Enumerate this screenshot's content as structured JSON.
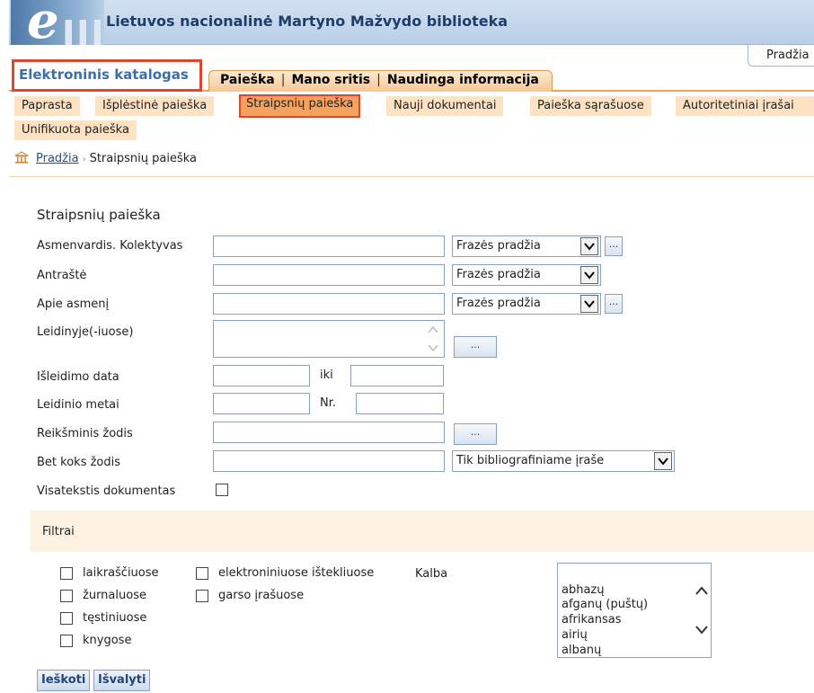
{
  "header": {
    "logo_letter": "e",
    "site_title": "Lietuvos nacionalinė Martyno Mažvydo biblioteka",
    "home_link": "Pradžia"
  },
  "tabs": {
    "catalog": "Elektroninis katalogas",
    "main": [
      "Paieška",
      "Mano sritis",
      "Naudinga informacija"
    ],
    "separator": "|"
  },
  "subtabs": [
    {
      "label": "Paprasta",
      "active": false
    },
    {
      "label": "Išplėstinė paieška",
      "active": false
    },
    {
      "label": "Straipsnių paieška",
      "active": true
    },
    {
      "label": "Nauji dokumentai",
      "active": false
    },
    {
      "label": "Paieška sąrašuose",
      "active": false
    },
    {
      "label": "Autoritetiniai įrašai",
      "active": false
    },
    {
      "label": "Unifikuota paieška",
      "active": false
    }
  ],
  "breadcrumb": {
    "home": "Pradžia",
    "separator": "›",
    "current": "Straipsnių paieška"
  },
  "form": {
    "title": "Straipsnių paieška",
    "fields": {
      "author": {
        "label": "Asmenvardis. Kolektyvas",
        "value": "",
        "mode": "Frazės pradžia"
      },
      "heading": {
        "label": "Antraštė",
        "value": "",
        "mode": "Frazės pradžia"
      },
      "about_person": {
        "label": "Apie asmenį",
        "value": "",
        "mode": "Frazės pradžia"
      },
      "in_publication": {
        "label": "Leidinyje(-iuose)",
        "value": ""
      },
      "issue_date": {
        "label": "Išleidimo data",
        "from": "",
        "to_label": "iki",
        "to": ""
      },
      "pub_year": {
        "label": "Leidinio metai",
        "value": "",
        "nr_label": "Nr.",
        "nr": ""
      },
      "keyword": {
        "label": "Reikšminis žodis",
        "value": ""
      },
      "any_word": {
        "label": "Bet koks žodis",
        "value": "",
        "mode": "Tik bibliografiniame įraše"
      },
      "fulltext": {
        "label": "Visatekstis dokumentas",
        "checked": false
      }
    },
    "lookup_label": "..."
  },
  "filters": {
    "title": "Filtrai",
    "options": [
      {
        "label": "laikraščiuose",
        "checked": false
      },
      {
        "label": "žurnaluose",
        "checked": false
      },
      {
        "label": "tęstiniuose",
        "checked": false
      },
      {
        "label": "knygose",
        "checked": false
      },
      {
        "label": "elektroniniuose ištekliuose",
        "checked": false
      },
      {
        "label": "garso įrašuose",
        "checked": false
      }
    ],
    "language_label": "Kalba",
    "languages": [
      "abhazų",
      "afganų (puštų)",
      "afrikansas",
      "airių",
      "albanų"
    ]
  },
  "buttons": {
    "search": "Ieškoti",
    "clear": "Išvalyti"
  },
  "colors": {
    "accent_orange": "#f5a25e",
    "highlight_red": "#e5442b",
    "header_blue": "#b8cfe8",
    "link_blue": "#1f4f8f"
  }
}
